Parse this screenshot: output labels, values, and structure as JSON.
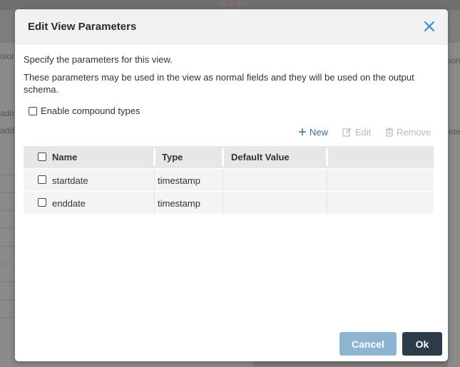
{
  "background": {
    "left_fragments": [
      "olor",
      "adm",
      "add"
    ],
    "right_fragments": [
      "ion",
      "ete"
    ]
  },
  "dialog": {
    "title": "Edit View Parameters",
    "description": "Specify the parameters for this view.",
    "description2": "These parameters may be used in the view as normal fields and they will be used on the output schema.",
    "compound_label": "Enable compound types",
    "compound_checked": false
  },
  "toolbar": {
    "new_label": "New",
    "edit_label": "Edit",
    "remove_label": "Remove"
  },
  "table": {
    "columns": [
      "Name",
      "Type",
      "Default Value",
      ""
    ],
    "rows": [
      {
        "name": "startdate",
        "type": "timestamp",
        "default": ""
      },
      {
        "name": "enddate",
        "type": "timestamp",
        "default": ""
      }
    ]
  },
  "footer": {
    "cancel_label": "Cancel",
    "ok_label": "Ok"
  },
  "colors": {
    "accent": "#3a6e9e",
    "cancel_bg": "#8db4d0",
    "ok_bg": "#2d3a47",
    "disabled": "#b6b9be"
  }
}
